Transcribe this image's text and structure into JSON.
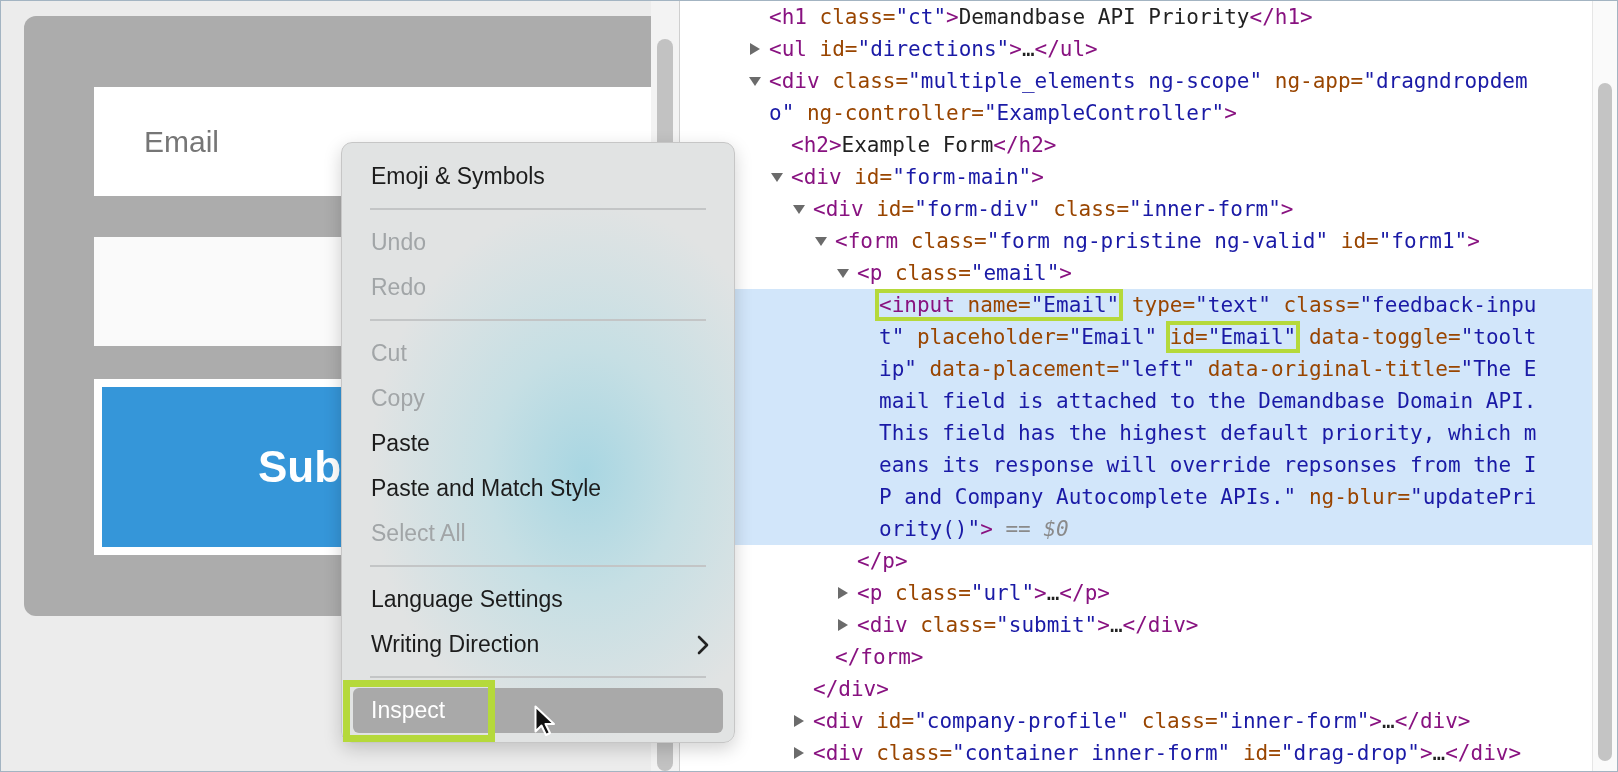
{
  "page": {
    "email_field": {
      "placeholder": "Email"
    },
    "submit_button": {
      "label": "Sub"
    }
  },
  "context_menu": {
    "items": [
      {
        "kind": "item",
        "label": "Emoji & Symbols",
        "disabled": false,
        "selected": false
      },
      {
        "kind": "separator"
      },
      {
        "kind": "item",
        "label": "Undo",
        "disabled": true,
        "selected": false
      },
      {
        "kind": "item",
        "label": "Redo",
        "disabled": true,
        "selected": false
      },
      {
        "kind": "separator"
      },
      {
        "kind": "item",
        "label": "Cut",
        "disabled": true,
        "selected": false
      },
      {
        "kind": "item",
        "label": "Copy",
        "disabled": true,
        "selected": false
      },
      {
        "kind": "item",
        "label": "Paste",
        "disabled": false,
        "selected": false
      },
      {
        "kind": "item",
        "label": "Paste and Match Style",
        "disabled": false,
        "selected": false
      },
      {
        "kind": "item",
        "label": "Select All",
        "disabled": true,
        "selected": false
      },
      {
        "kind": "separator"
      },
      {
        "kind": "item",
        "label": "Language Settings",
        "disabled": false,
        "selected": false
      },
      {
        "kind": "item",
        "label": "Writing Direction",
        "disabled": false,
        "selected": false,
        "submenu": true
      },
      {
        "kind": "separator"
      },
      {
        "kind": "item",
        "label": "Inspect",
        "disabled": false,
        "selected": true,
        "callout": true
      }
    ]
  },
  "devtools": {
    "nodes": [
      {
        "selected": false,
        "tokens": [
          {
            "kind": "tag",
            "text": "<h1"
          },
          {
            "kind": "attr",
            "text": " class="
          },
          {
            "kind": "value",
            "text": "\"ct\""
          },
          {
            "kind": "tag",
            "text": ">"
          },
          {
            "kind": "text",
            "text": "Demandbase API Priority"
          },
          {
            "kind": "tag",
            "text": "</h1>"
          }
        ]
      },
      {
        "selected": false,
        "expanded": false,
        "tokens": [
          {
            "kind": "tag",
            "text": "<ul"
          },
          {
            "kind": "attr",
            "text": " id="
          },
          {
            "kind": "value",
            "text": "\"directions\""
          },
          {
            "kind": "tag",
            "text": ">"
          },
          {
            "kind": "text",
            "text": "…"
          },
          {
            "kind": "tag",
            "text": "</ul>"
          }
        ]
      },
      {
        "selected": false,
        "expanded": true,
        "tokens": [
          {
            "kind": "tag",
            "text": "<div"
          },
          {
            "kind": "attr",
            "text": " class="
          },
          {
            "kind": "value",
            "text": "\"multiple_elements ng-scope\""
          },
          {
            "kind": "attr",
            "text": " ng-app="
          },
          {
            "kind": "value",
            "text": "\"dragndropdemo\""
          },
          {
            "kind": "attr",
            "text": " ng-controller="
          },
          {
            "kind": "value",
            "text": "\"ExampleController\""
          },
          {
            "kind": "tag",
            "text": ">"
          }
        ],
        "children": [
          {
            "selected": false,
            "tokens": [
              {
                "kind": "tag",
                "text": "<h2>"
              },
              {
                "kind": "text",
                "text": "Example Form"
              },
              {
                "kind": "tag",
                "text": "</h2>"
              }
            ]
          },
          {
            "selected": false,
            "expanded": true,
            "tokens": [
              {
                "kind": "tag",
                "text": "<div"
              },
              {
                "kind": "attr",
                "text": " id="
              },
              {
                "kind": "value",
                "text": "\"form-main\""
              },
              {
                "kind": "tag",
                "text": ">"
              }
            ],
            "children": [
              {
                "selected": false,
                "expanded": true,
                "tokens": [
                  {
                    "kind": "tag",
                    "text": "<div"
                  },
                  {
                    "kind": "attr",
                    "text": " id="
                  },
                  {
                    "kind": "value",
                    "text": "\"form-div\""
                  },
                  {
                    "kind": "attr",
                    "text": " class="
                  },
                  {
                    "kind": "value",
                    "text": "\"inner-form\""
                  },
                  {
                    "kind": "tag",
                    "text": ">"
                  }
                ],
                "close": [
                  {
                    "kind": "tag",
                    "text": "</div>"
                  }
                ],
                "children": [
                  {
                    "selected": false,
                    "expanded": true,
                    "tokens": [
                      {
                        "kind": "tag",
                        "text": "<form"
                      },
                      {
                        "kind": "attr",
                        "text": " class="
                      },
                      {
                        "kind": "value",
                        "text": "\"form ng-pristine ng-valid\""
                      },
                      {
                        "kind": "attr",
                        "text": " id="
                      },
                      {
                        "kind": "value",
                        "text": "\"form1\""
                      },
                      {
                        "kind": "tag",
                        "text": ">"
                      }
                    ],
                    "close": [
                      {
                        "kind": "tag",
                        "text": "</form>"
                      }
                    ],
                    "children": [
                      {
                        "selected": false,
                        "expanded": true,
                        "tokens": [
                          {
                            "kind": "tag",
                            "text": "<p"
                          },
                          {
                            "kind": "attr",
                            "text": " class="
                          },
                          {
                            "kind": "value",
                            "text": "\"email\""
                          },
                          {
                            "kind": "tag",
                            "text": ">"
                          }
                        ],
                        "close": [
                          {
                            "kind": "tag",
                            "text": "</p>"
                          }
                        ],
                        "children": [
                          {
                            "selected": true,
                            "tokens": [
                              {
                                "kind": "callout",
                                "tokens": [
                                  {
                                    "kind": "tag",
                                    "text": "<input"
                                  },
                                  {
                                    "kind": "attr",
                                    "text": " name="
                                  },
                                  {
                                    "kind": "value",
                                    "text": "\"Email\""
                                  }
                                ]
                              },
                              {
                                "kind": "attr",
                                "text": " type="
                              },
                              {
                                "kind": "value",
                                "text": "\"text\""
                              },
                              {
                                "kind": "attr",
                                "text": " class="
                              },
                              {
                                "kind": "value",
                                "text": "\"feedback-input\""
                              },
                              {
                                "kind": "attr",
                                "text": " placeholder="
                              },
                              {
                                "kind": "value",
                                "text": "\"Email\" "
                              },
                              {
                                "kind": "callout",
                                "tokens": [
                                  {
                                    "kind": "attr",
                                    "text": "id="
                                  },
                                  {
                                    "kind": "value",
                                    "text": "\"Email\""
                                  }
                                ]
                              },
                              {
                                "kind": "attr",
                                "text": " data-toggle="
                              },
                              {
                                "kind": "value",
                                "text": "\"tooltip\""
                              },
                              {
                                "kind": "attr",
                                "text": " data-placement="
                              },
                              {
                                "kind": "value",
                                "text": "\"left\""
                              },
                              {
                                "kind": "attr",
                                "text": " data-original-title="
                              },
                              {
                                "kind": "value",
                                "text": "\"The Email field is attached to the Demandbase Domain API. This field has the highest default priority, which means its response will override repsonses from the IP and Company Autocomplete APIs.\""
                              },
                              {
                                "kind": "attr",
                                "text": " ng-blur="
                              },
                              {
                                "kind": "value",
                                "text": "\"updatePriority()\""
                              },
                              {
                                "kind": "tag",
                                "text": ">"
                              },
                              {
                                "kind": "marker",
                                "text": " == $0"
                              }
                            ]
                          }
                        ]
                      },
                      {
                        "selected": false,
                        "expanded": false,
                        "tokens": [
                          {
                            "kind": "tag",
                            "text": "<p"
                          },
                          {
                            "kind": "attr",
                            "text": " class="
                          },
                          {
                            "kind": "value",
                            "text": "\"url\""
                          },
                          {
                            "kind": "tag",
                            "text": ">"
                          },
                          {
                            "kind": "text",
                            "text": "…"
                          },
                          {
                            "kind": "tag",
                            "text": "</p>"
                          }
                        ]
                      },
                      {
                        "selected": false,
                        "expanded": false,
                        "tokens": [
                          {
                            "kind": "tag",
                            "text": "<div"
                          },
                          {
                            "kind": "attr",
                            "text": " class="
                          },
                          {
                            "kind": "value",
                            "text": "\"submit\""
                          },
                          {
                            "kind": "tag",
                            "text": ">"
                          },
                          {
                            "kind": "text",
                            "text": "…"
                          },
                          {
                            "kind": "tag",
                            "text": "</div>"
                          }
                        ]
                      }
                    ]
                  }
                ]
              },
              {
                "selected": false,
                "expanded": false,
                "tokens": [
                  {
                    "kind": "tag",
                    "text": "<div"
                  },
                  {
                    "kind": "attr",
                    "text": " id="
                  },
                  {
                    "kind": "value",
                    "text": "\"company-profile\""
                  },
                  {
                    "kind": "attr",
                    "text": " class="
                  },
                  {
                    "kind": "value",
                    "text": "\"inner-form\""
                  },
                  {
                    "kind": "tag",
                    "text": ">"
                  },
                  {
                    "kind": "text",
                    "text": "…"
                  },
                  {
                    "kind": "tag",
                    "text": "</div>"
                  }
                ]
              },
              {
                "selected": false,
                "expanded": false,
                "tokens": [
                  {
                    "kind": "tag",
                    "text": "<div"
                  },
                  {
                    "kind": "attr",
                    "text": " class="
                  },
                  {
                    "kind": "value",
                    "text": "\"container inner-form\""
                  },
                  {
                    "kind": "attr",
                    "text": " id="
                  },
                  {
                    "kind": "value",
                    "text": "\"drag-drop\""
                  },
                  {
                    "kind": "tag",
                    "text": ">"
                  },
                  {
                    "kind": "text",
                    "text": "…"
                  },
                  {
                    "kind": "tag",
                    "text": "</div>"
                  }
                ]
              }
            ]
          }
        ]
      }
    ]
  }
}
